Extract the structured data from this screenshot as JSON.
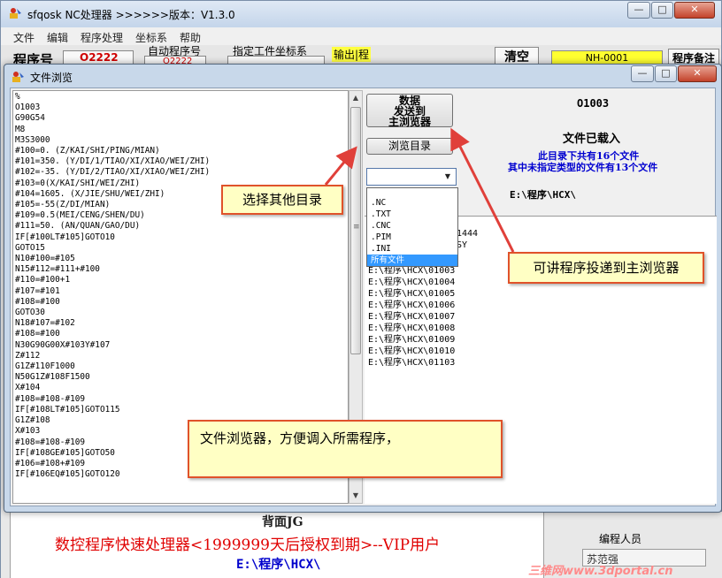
{
  "main_window": {
    "title": "sfqosk NC处理器 >>>>>>版本：V1.3.0",
    "buttons": {
      "minimize": "—",
      "maximize": "□",
      "close": "✕"
    },
    "menu": [
      "文件",
      "编辑",
      "程序处理",
      "坐标系",
      "帮助"
    ],
    "toolbar": {
      "program_label": "程序号",
      "program_value": "O2222",
      "auto_program_label": "自动程序号",
      "auto_program_value": "O2222",
      "coord_label": "指定工件坐标系",
      "output_label": "输出|程",
      "clear_button": "清空",
      "machine_value": "NH-0001",
      "note_button": "程序备注"
    },
    "bottom": {
      "subtitle": "背面JG",
      "banner": "数控程序快速处理器<1999999天后授权到期>--VIP用户",
      "path": "E:\\程序\\HCX\\",
      "programmer_label": "编程人员",
      "programmer_value": "苏范强",
      "watermark": "三维网www.3dportal.cn"
    }
  },
  "dialog": {
    "title": "文件浏览",
    "buttons": {
      "minimize": "—",
      "maximize": "□",
      "close": "✕"
    },
    "code_lines": "%\nO1003\nG90G54\nM8\nM3S3000\n#100=0. (Z/KAI/SHI/PING/MIAN)\n#101=350. (Y/DI/1/TIAO/XI/XIAO/WEI/ZHI)\n#102=-35. (Y/DI/2/TIAO/XI/XIAO/WEI/ZHI)\n#103=0(X/KAI/SHI/WEI/ZHI)\n#104=1605. (X/JIE/SHU/WEI/ZHI)\n#105=-55(Z/DI/MIAN)\n#109=0.5(MEI/CENG/SHEN/DU)\n#111=50. (AN/QUAN/GAO/DU)\nIF[#100LT#105]GOTO10\nGOTO15\nN10#100=#105\nN15#112=#111+#100\n#110=#100+1\n#107=#101\n#108=#100\nGOTO30\nN18#107=#102\n#108=#100\nN30G90G00X#103Y#107\nZ#112\nG1Z#110F1000\nN50G1Z#108F1500\nX#104\n#108=#108-#109\nIF[#108LT#105]GOTO115\nG1Z#108\nX#103\n#108=#108-#109\nIF[#108GE#105]GOTO50\n#106=#108+#109\nIF[#106EQ#105]GOTO120",
    "send_button": "数据\n发送到\n主浏览器",
    "browse_dir_button": "浏览目录",
    "program_number": "O1003",
    "loaded_status": "文件已载入",
    "dir_count": "此目录下共有16个文件",
    "unspecified_count": "其中未指定类型的文件有13个文件",
    "current_dir": "E:\\程序\\HCX\\",
    "filter_options": [
      ".NC",
      ".TXT",
      ".CNC",
      ".PIM",
      ".INI",
      "所有文件"
    ],
    "filter_selected_index": 5,
    "file_list_partial": [
      "1444",
      "SY",
      "E:\\程序\\HCX\\01003"
    ],
    "file_list": [
      "E:\\程序\\HCX\\01004",
      "E:\\程序\\HCX\\01005",
      "E:\\程序\\HCX\\01006",
      "E:\\程序\\HCX\\01007",
      "E:\\程序\\HCX\\01008",
      "E:\\程序\\HCX\\01009",
      "E:\\程序\\HCX\\01010",
      "E:\\程序\\HCX\\01103"
    ]
  },
  "callouts": {
    "select_dir": "选择其他目录",
    "send_to_main": "可讲程序投递到主浏览器",
    "file_browser": "文件浏览器，方便调入所需程序，"
  },
  "colors": {
    "callout_border": "#e0522a",
    "callout_fill": "#ffffc4",
    "arrow": "#e0403a",
    "banner_red": "#e00000",
    "info_blue": "#0000d0",
    "selection": "#3399ff"
  }
}
